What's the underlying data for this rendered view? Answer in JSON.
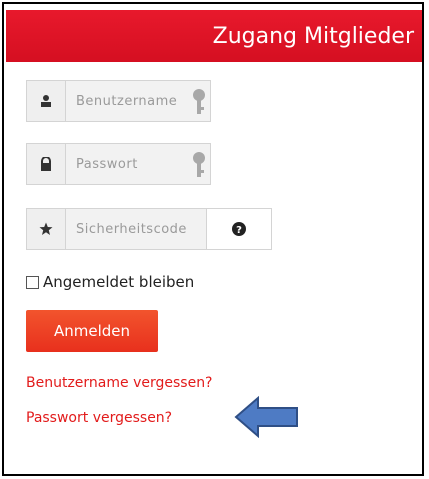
{
  "header": {
    "title": "Zugang Mitglieder"
  },
  "form": {
    "username_placeholder": "Benutzername",
    "password_placeholder": "Passwort",
    "security_placeholder": "Sicherheitscode",
    "remember_label": "Angemeldet bleiben",
    "login_label": "Anmelden"
  },
  "links": {
    "forgot_username": "Benutzername vergessen?",
    "forgot_password": "Passwort vergessen?"
  },
  "colors": {
    "header": "#e01427",
    "button": "#ef4625",
    "link": "#e21b1b",
    "arrow": "#4e7bc4"
  }
}
